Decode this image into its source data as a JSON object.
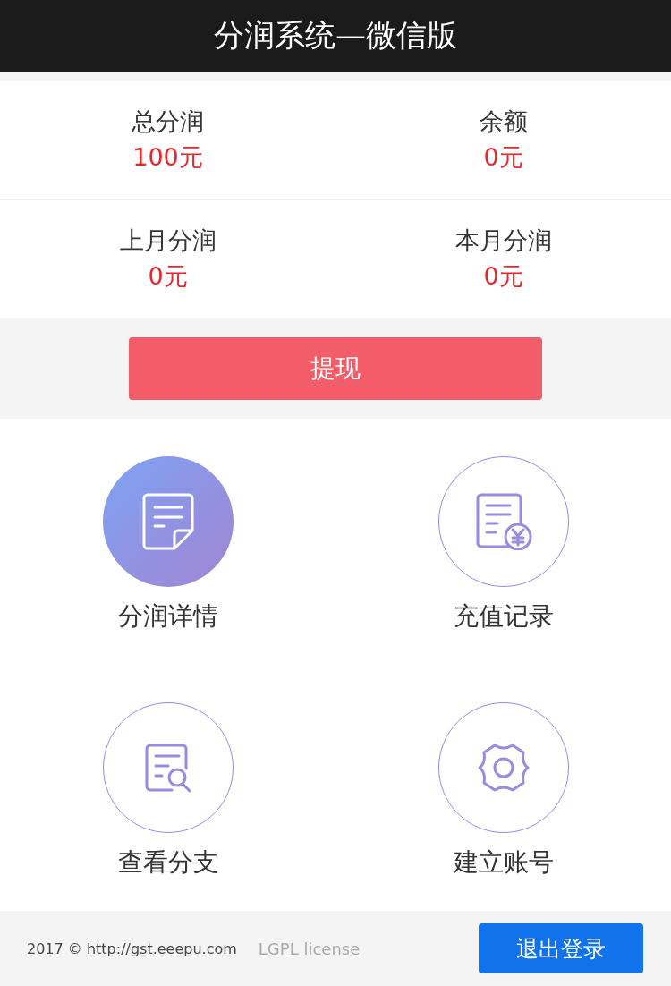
{
  "header": {
    "title": "分润系统—微信版"
  },
  "stats": [
    {
      "label": "总分润",
      "value": "100元"
    },
    {
      "label": "余额",
      "value": "0元"
    },
    {
      "label": "上月分润",
      "value": "0元"
    },
    {
      "label": "本月分润",
      "value": "0元"
    }
  ],
  "withdraw_button": "提现",
  "menu": [
    {
      "kind": "document",
      "label": "分润详情",
      "selected": true
    },
    {
      "kind": "receipt",
      "label": "充值记录",
      "selected": false
    },
    {
      "kind": "search",
      "label": "查看分支",
      "selected": false
    },
    {
      "kind": "gear",
      "label": "建立账号",
      "selected": false
    }
  ],
  "footer": {
    "copyright": "2017 © http://gst.eeepu.com",
    "license": "LGPL  license",
    "logout_button": "退出登录"
  }
}
